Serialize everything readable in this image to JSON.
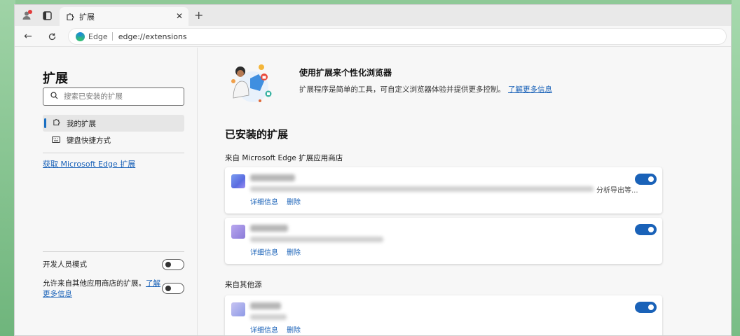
{
  "browser": {
    "tab_title": "扩展",
    "omnibox_label": "Edge",
    "url": "edge://extensions"
  },
  "sidebar": {
    "title": "扩展",
    "search_placeholder": "搜索已安装的扩展",
    "items": [
      {
        "label": "我的扩展",
        "icon": "puzzle-icon"
      },
      {
        "label": "键盘快捷方式",
        "icon": "keyboard-icon"
      }
    ],
    "get_extensions_link": "获取 Microsoft Edge 扩展",
    "developer_mode_label": "开发人员模式",
    "allow_other_stores_label": "允许来自其他应用商店的扩展。",
    "allow_other_stores_link": "了解更多信息"
  },
  "main": {
    "hero_title": "使用扩展来个性化浏览器",
    "hero_desc": "扩展程序是简单的工具，可自定义浏览器体验并提供更多控制。",
    "hero_link": "了解更多信息",
    "installed_title": "已安装的扩展",
    "store_section_label": "来自 Microsoft Edge 扩展应用商店",
    "other_section_label": "来自其他源",
    "details_label": "详细信息",
    "remove_label": "删除",
    "card1_desc_tail": "分析导出等..."
  },
  "colors": {
    "accent": "#1a62b8",
    "toggle_on": "#1a62b8"
  }
}
